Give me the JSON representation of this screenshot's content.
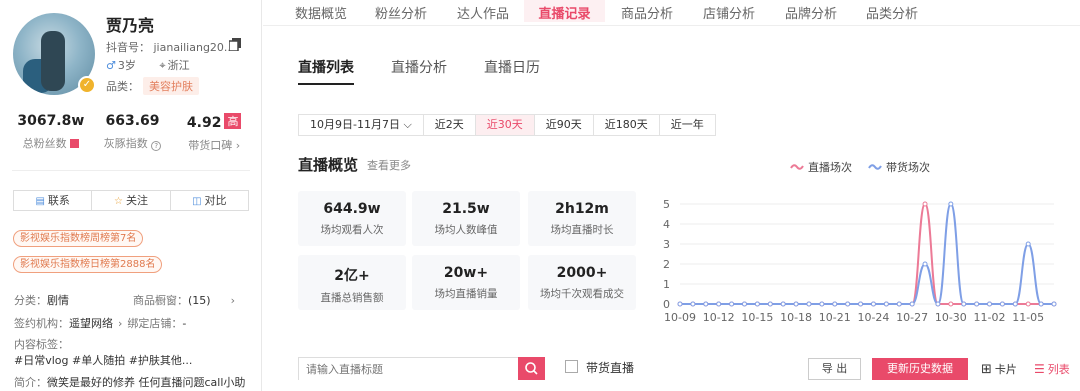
{
  "profile": {
    "name": "贾乃亮",
    "douyin_id": "抖音号： jianailiang20...",
    "age": "3岁",
    "location": "浙江",
    "category_label": "品类：",
    "category_tag": "美容护肤",
    "stats": [
      {
        "value": "3067.8w",
        "label": "总粉丝数"
      },
      {
        "value": "663.69",
        "label": "灰豚指数"
      },
      {
        "value": "4.92",
        "badge": "高",
        "label": "带货口碑 ›"
      }
    ],
    "buttons": {
      "contact": "联系",
      "follow": "关注",
      "compare": "对比"
    },
    "ranks": [
      "影视娱乐指数榜周榜第7名",
      "影视娱乐指数榜日榜第2888名"
    ],
    "info": {
      "category_label": "分类：",
      "category_value": "剧情",
      "window_label": "商品橱窗：",
      "window_value": "(15)",
      "org_label": "签约机构：",
      "org_value": "遥望网络",
      "shop_label": "绑定店铺：",
      "shop_value": "-",
      "tags_label": "内容标签：",
      "tags_value": "#日常vlog  #单人随拍  #护肤其他...",
      "intro_label": "简介：",
      "intro_value": "微笑是最好的修养 任何直播问题call小助"
    }
  },
  "top_tabs": [
    {
      "label": "数据概览",
      "active": false
    },
    {
      "label": "粉丝分析",
      "active": false
    },
    {
      "label": "达人作品",
      "active": false
    },
    {
      "label": "直播记录",
      "active": true
    },
    {
      "label": "商品分析",
      "active": false
    },
    {
      "label": "店铺分析",
      "active": false
    },
    {
      "label": "品牌分析",
      "active": false
    },
    {
      "label": "品类分析",
      "active": false
    }
  ],
  "sub_tabs": [
    {
      "label": "直播列表",
      "active": true
    },
    {
      "label": "直播分析",
      "active": false
    },
    {
      "label": "直播日历",
      "active": false
    }
  ],
  "ranges": [
    {
      "label": "10月9日-11月7日 ⌵",
      "active": false
    },
    {
      "label": "近2天",
      "active": false
    },
    {
      "label": "近30天",
      "active": true
    },
    {
      "label": "近90天",
      "active": false
    },
    {
      "label": "近180天",
      "active": false
    },
    {
      "label": "近一年",
      "active": false
    }
  ],
  "overview": {
    "title": "直播概览",
    "more": "查看更多",
    "kpis": [
      {
        "value": "644.9w",
        "label": "场均观看人次"
      },
      {
        "value": "21.5w",
        "label": "场均人数峰值"
      },
      {
        "value": "2h12m",
        "label": "场均直播时长"
      },
      {
        "value": "2亿+",
        "label": "直播总销售额"
      },
      {
        "value": "20w+",
        "label": "场均直播销量"
      },
      {
        "value": "2000+",
        "label": "场均千次观看成交"
      }
    ]
  },
  "chart_data": {
    "type": "line",
    "x": [
      "10-09",
      "10-10",
      "10-11",
      "10-12",
      "10-13",
      "10-14",
      "10-15",
      "10-16",
      "10-17",
      "10-18",
      "10-19",
      "10-20",
      "10-21",
      "10-22",
      "10-23",
      "10-24",
      "10-25",
      "10-26",
      "10-27",
      "10-28",
      "10-29",
      "10-30",
      "10-31",
      "11-01",
      "11-02",
      "11-03",
      "11-04",
      "11-05",
      "11-06",
      "11-07"
    ],
    "x_tick_labels": [
      "10-09",
      "10-12",
      "10-15",
      "10-18",
      "10-21",
      "10-24",
      "10-27",
      "10-30",
      "11-02",
      "11-05"
    ],
    "series": [
      {
        "name": "直播场次",
        "color": "#ec7a96",
        "values": [
          0,
          0,
          0,
          0,
          0,
          0,
          0,
          0,
          0,
          0,
          0,
          0,
          0,
          0,
          0,
          0,
          0,
          0,
          0,
          5,
          0,
          0,
          0,
          0,
          0,
          0,
          0,
          0,
          0,
          0
        ]
      },
      {
        "name": "带货场次",
        "color": "#7f9fe6",
        "values": [
          0,
          0,
          0,
          0,
          0,
          0,
          0,
          0,
          0,
          0,
          0,
          0,
          0,
          0,
          0,
          0,
          0,
          0,
          0,
          2,
          0,
          5,
          0,
          0,
          0,
          0,
          0,
          3,
          0,
          0
        ]
      }
    ],
    "ylim": [
      0,
      5
    ],
    "y_ticks": [
      0,
      1,
      2,
      3,
      4,
      5
    ],
    "grid": true,
    "legend": "top-right"
  },
  "toolbar": {
    "search_placeholder": "请输入直播标题",
    "with_goods": "带货直播",
    "export": "导 出",
    "update": "更新历史数据",
    "card_view": "卡片",
    "list_view": "列表"
  },
  "colors": {
    "accent": "#e94a6a",
    "rank": "#e07a4f"
  }
}
